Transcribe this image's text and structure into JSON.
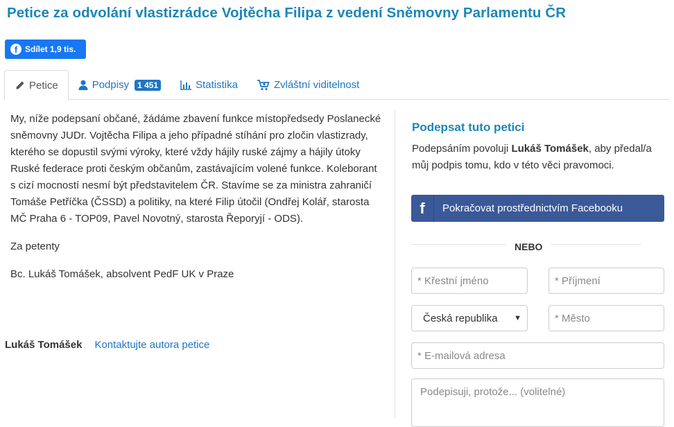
{
  "page": {
    "title": "Petice za odvolání vlastizrádce Vojtěcha Filipa z vedení Sněmovny Parlamentu ČR"
  },
  "share": {
    "label": "Sdílet 1,9 tis.",
    "icon": "facebook-icon"
  },
  "tabs": [
    {
      "label": "Petice",
      "icon": "pencil-icon",
      "active": true
    },
    {
      "label": "Podpisy",
      "icon": "user-icon",
      "badge": "1 451"
    },
    {
      "label": "Statistika",
      "icon": "bar-chart-icon"
    },
    {
      "label": "Zvláštní viditelnost",
      "icon": "cart-icon"
    }
  ],
  "petition": {
    "paragraphs": [
      "My, níže podepsaní občané, žádáme zbavení funkce místopředsedy Poslanecké sněmovny JUDr. Vojtěcha Filipa a jeho případné stíhání pro zločin vlastizrady, kterého se dopustil svými výroky, které vždy hájily ruské zájmy a hájily útoky Ruské federace proti českým občanům, zastávajícím volené funkce. Koleborant s cizí mocností nesmí být představitelem ČR. Stavíme se za ministra zahraničí Tomáše Petříčka (ČSSD) a politiky, na které Filip útočil (Ondřej Kolář, starosta MČ Praha 6 - TOP09, Pavel Novotný, starosta Řeporyjí - ODS).",
      "Za petenty",
      "Bc. Lukáš Tomášek, absolvent PedF UK v Praze"
    ],
    "author": "Lukáš Tomášek",
    "contact_link": "Kontaktujte autora petice"
  },
  "sign": {
    "title": "Podepsat tuto petici",
    "desc_prefix": "Podepsáním povoluji ",
    "desc_author": "Lukáš Tomášek",
    "desc_suffix": ", aby předal/a můj podpis tomu, kdo v této věci pravomoci.",
    "facebook_button": "Pokračovat prostřednictvím Facebooku",
    "or_label": "NEBO",
    "first_name_placeholder": "* Křestní jméno",
    "last_name_placeholder": "* Příjmení",
    "country_value": "Česká republika",
    "city_placeholder": "* Město",
    "email_placeholder": "* E-mailová adresa",
    "reason_placeholder": "Podepisuji, protože... (volitelné)"
  },
  "colors": {
    "title_blue": "#1a87b8",
    "link_blue": "#1f76c4",
    "facebook_share": "#1877f2",
    "facebook_button": "#3b5998"
  }
}
